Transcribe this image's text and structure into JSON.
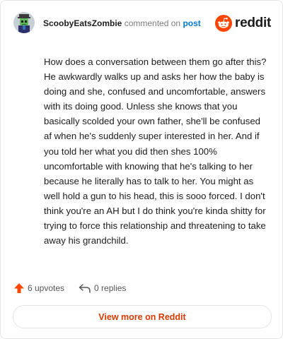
{
  "header": {
    "username": "ScoobyEatsZombie",
    "commented_text": "commented on",
    "post_link": "post",
    "brand": "reddit"
  },
  "comment": {
    "body": "How does a conversation between them go after this? He awkwardly walks up and asks her how the baby is doing and she, confused and uncomfortable, answers with its doing good. Unless she knows that you basically scolded your own father, she'll be confused af when he's suddenly super interested in her. And if you told her what you did then shes 100% uncomfortable with knowing that he's talking to her because he literally has to talk to her. You might as well hold a gun to his head, this is sooo forced. I don't think you're an AH but I do think you're kinda shitty for trying to force this relationship and threatening to take away his grandchild."
  },
  "actions": {
    "upvotes": "6 upvotes",
    "replies": "0 replies"
  },
  "footer": {
    "view_more": "View more on Reddit"
  },
  "colors": {
    "brand_orange": "#ff4500",
    "link_blue": "#0079d3",
    "view_more_text": "#d93a00"
  },
  "icons": {
    "avatar": "zombie-avatar",
    "logo": "reddit-snoo-icon",
    "upvote": "upvote-arrow-icon",
    "reply": "reply-arrow-icon"
  }
}
